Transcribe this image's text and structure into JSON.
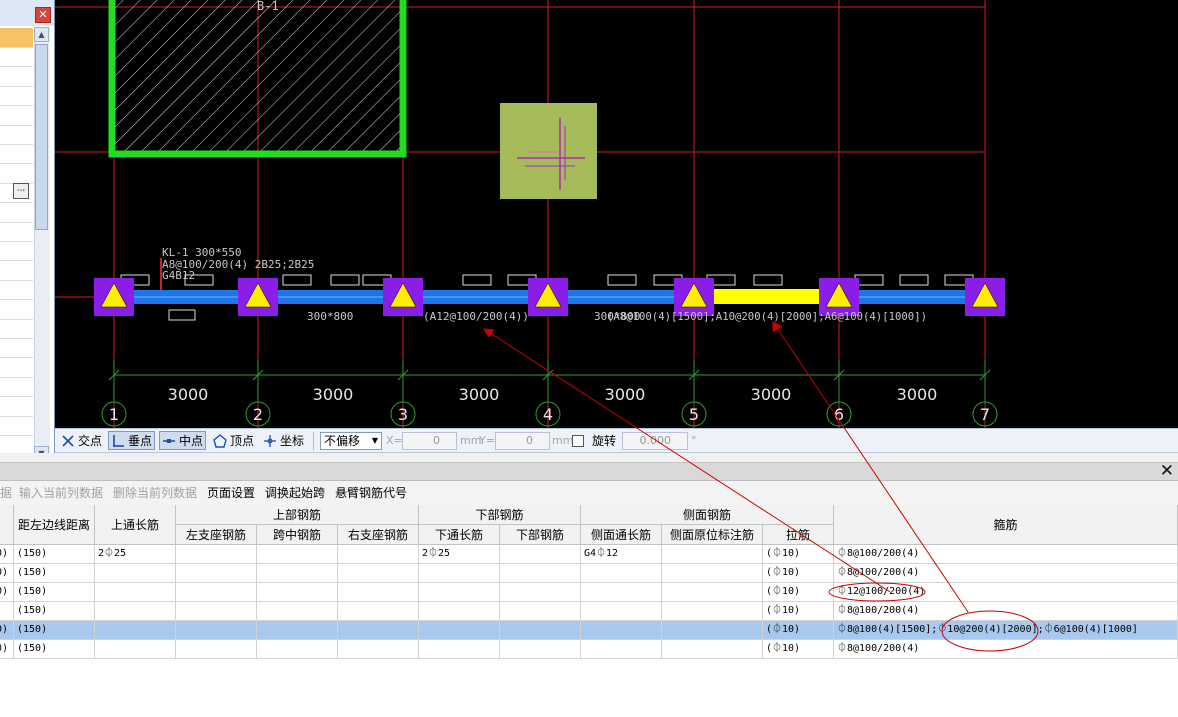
{
  "left_panel": {
    "close_glyph": "✕",
    "ellipsis_glyph": "···",
    "scroll_up": "▲",
    "scroll_down": "▼",
    "scroll_mid": "≡"
  },
  "canvas": {
    "top_label": "B-1",
    "beam_label": {
      "line1": "KL-1 300*550",
      "line2": "A8@100/200(4) 2B25;2B25",
      "line3": "G4B12"
    },
    "span_labels": [
      "300*800",
      "(A12@100/200(4))",
      "300*800",
      "(A8@100(4)[1500];A10@200(4)[2000];A6@100(4)[1000])"
    ],
    "dimensions": [
      "3000",
      "3000",
      "3000",
      "3000",
      "3000",
      "3000"
    ],
    "axis_numbers": [
      "1",
      "2",
      "3",
      "4",
      "5",
      "6",
      "7"
    ],
    "colors": {
      "grid": "#cc1f1f",
      "beam": "#1f74e8",
      "support": "#8a1de8",
      "triangle": "#ffee00",
      "highlight": "#ffff00",
      "column_frame": "#22dd22",
      "pad": "#a5bb5a",
      "axis": "#2e9e2e"
    }
  },
  "snap_toolbar": {
    "items": [
      {
        "icon": "intersection-icon",
        "label": "交点"
      },
      {
        "icon": "perpendicular-icon",
        "label": "垂点"
      },
      {
        "icon": "midpoint-icon",
        "label": "中点"
      },
      {
        "icon": "vertex-icon",
        "label": "顶点"
      },
      {
        "icon": "coordinate-icon",
        "label": "坐标"
      }
    ],
    "offset_mode": "不偏移",
    "x_label": "X=",
    "x_value": "0",
    "x_unit": "mm",
    "y_label": "Y=",
    "y_value": "0",
    "y_unit": "mm",
    "rotate_label": "旋转",
    "rotate_value": "0.000",
    "rotate_unit": "°"
  },
  "bottom_panel": {
    "close_glyph": "✕",
    "menu": [
      {
        "label": "据",
        "disabled": true
      },
      {
        "label": "输入当前列数据",
        "disabled": true
      },
      {
        "label": "删除当前列数据",
        "disabled": true
      },
      {
        "label": "页面设置",
        "disabled": false
      },
      {
        "label": "调换起始跨",
        "disabled": false
      },
      {
        "label": "悬臂钢筋代号",
        "disabled": false
      }
    ],
    "headers": {
      "left_edge_distance": "距左边线距离",
      "top_through": "上通长筋",
      "top_group": "上部钢筋",
      "left_support": "左支座钢筋",
      "mid_span": "跨中钢筋",
      "right_support": "右支座钢筋",
      "bottom_group": "下部钢筋",
      "bottom_through": "下通长筋",
      "bottom_rebar": "下部钢筋",
      "side_group": "侧面钢筋",
      "side_through": "侧面通长筋",
      "side_original": "侧面原位标注筋",
      "tie": "拉筋",
      "stirrup": "箍筋"
    },
    "rows": [
      {
        "c0": "0)",
        "dist": "(150)",
        "top_through": "2⏀25",
        "bottom_through": "2⏀25",
        "side_through": "G4⏀12",
        "tie": "(⏀10)",
        "stirrup": "⏀8@100/200(4)"
      },
      {
        "c0": "0)",
        "dist": "(150)",
        "top_through": "",
        "bottom_through": "",
        "side_through": "",
        "tie": "(⏀10)",
        "stirrup": "⏀8@100/200(4)"
      },
      {
        "c0": "0)",
        "dist": "(150)",
        "top_through": "",
        "bottom_through": "",
        "side_through": "",
        "tie": "(⏀10)",
        "stirrup": "⏀12@100/200(4)"
      },
      {
        "c0": ")",
        "dist": "(150)",
        "top_through": "",
        "bottom_through": "",
        "side_through": "",
        "tie": "(⏀10)",
        "stirrup": "⏀8@100/200(4)"
      },
      {
        "c0": "0)",
        "dist": "(150)",
        "top_through": "",
        "bottom_through": "",
        "side_through": "",
        "tie": "(⏀10)",
        "stirrup": "⏀8@100(4)[1500];⏀10@200(4)[2000];⏀6@100(4)[1000]",
        "selected": true
      },
      {
        "c0": "0)",
        "dist": "(150)",
        "top_through": "",
        "bottom_through": "",
        "side_through": "",
        "tie": "(⏀10)",
        "stirrup": "⏀8@100/200(4)"
      }
    ]
  },
  "annotation_color": "#cc0000"
}
